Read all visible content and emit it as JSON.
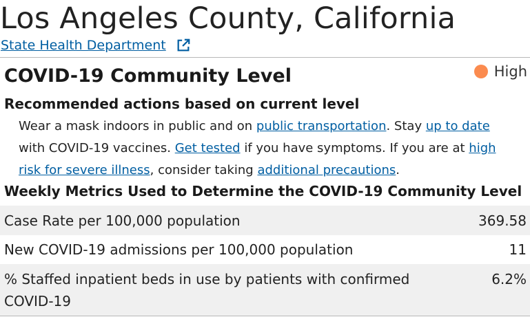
{
  "header": {
    "title": "Los Angeles County, California",
    "state_link": "State Health Department"
  },
  "community_level": {
    "heading": "COVID-19 Community Level",
    "level_label": "High",
    "level_color": "#fb8b4f"
  },
  "recommendations": {
    "heading": "Recommended actions based on current level",
    "text_1": "Wear a mask indoors in public and on ",
    "link_public_transportation": "public transportation",
    "text_2": ". Stay ",
    "link_up_to_date": "up to date",
    "text_3": " with COVID-19 vaccines. ",
    "link_get_tested": "Get tested",
    "text_4": " if you have symptoms. If you are at ",
    "link_high_risk": "high risk for severe illness",
    "text_5": ", consider taking ",
    "link_additional_precautions": "additional precautions",
    "text_6": "."
  },
  "metrics": {
    "heading": "Weekly Metrics Used to Determine the COVID-19 Community Level",
    "rows": [
      {
        "label": "Case Rate per 100,000 population",
        "value": "369.58"
      },
      {
        "label": "New COVID-19 admissions per 100,000 population",
        "value": "11"
      },
      {
        "label": "% Staffed inpatient beds in use by patients with confirmed COVID-19",
        "value": "6.2%"
      }
    ]
  },
  "colors": {
    "link": "#005ea2",
    "row_alt": "#f0f0f0"
  },
  "icons": {
    "external_link": "external-link-icon"
  }
}
